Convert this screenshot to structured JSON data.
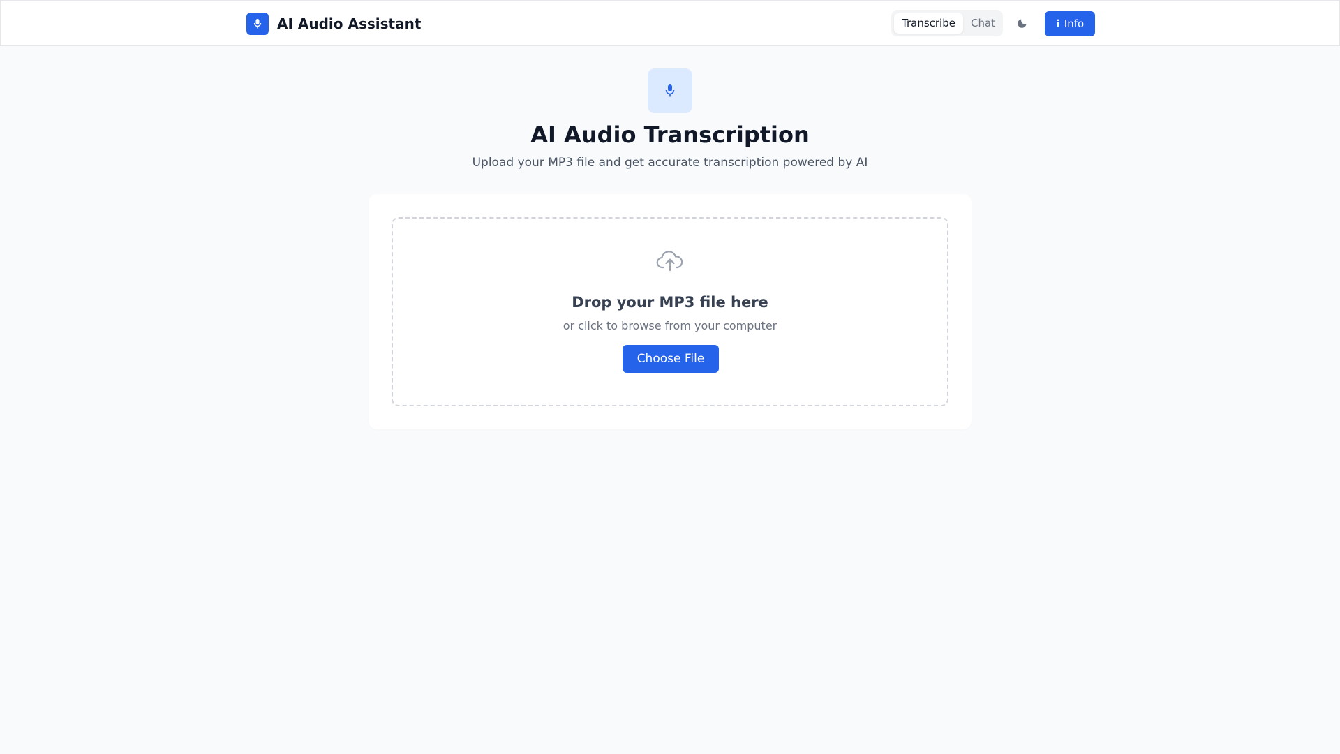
{
  "app": {
    "title": "AI Audio Assistant",
    "logo_icon": "microphone-icon"
  },
  "nav": {
    "tabs": [
      {
        "label": "Transcribe",
        "active": true
      },
      {
        "label": "Chat",
        "active": false
      }
    ],
    "theme_toggle_icon": "moon-icon",
    "info_label": "Info",
    "info_icon": "info-icon"
  },
  "hero": {
    "icon": "microphone-icon",
    "title": "AI Audio Transcription",
    "subtitle": "Upload your MP3 file and get accurate transcription powered by AI"
  },
  "upload": {
    "icon": "upload-cloud-icon",
    "title": "Drop your MP3 file here",
    "subtitle": "or click to browse from your computer",
    "button_label": "Choose File"
  },
  "colors": {
    "accent": "#2563eb",
    "background": "#f8fafc",
    "hero_icon_bg": "#dbeafe"
  }
}
